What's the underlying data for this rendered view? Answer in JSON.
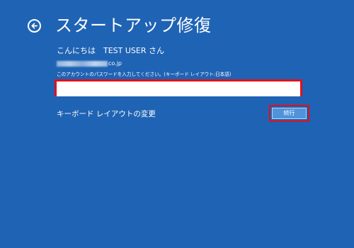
{
  "page": {
    "title": "スタートアップ修復",
    "back_icon": "back-arrow-circle-icon"
  },
  "greeting": "こんにちは　TEST USER さん",
  "account": {
    "email_suffix": "co.jp"
  },
  "password": {
    "prompt": "このアカウントのパスワードを入力してください。(キーボード レイアウト:日本語)",
    "value": "",
    "placeholder": ""
  },
  "keyboard_layout_link": "キーボード レイアウトの変更",
  "continue_label": "続行",
  "colors": {
    "background": "#1f63b4",
    "highlight": "#e0101c",
    "button": "#4f93db"
  }
}
